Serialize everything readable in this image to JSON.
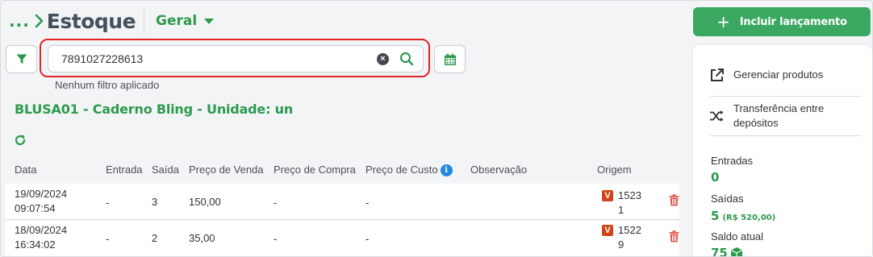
{
  "header": {
    "breadcrumb_dots": "...",
    "title": "Estoque",
    "view_selector": "Geral"
  },
  "toolbar": {
    "search_value": "7891027228613",
    "search_placeholder": "",
    "no_filter_text": "Nenhum filtro aplicado"
  },
  "product": {
    "title": "BLUSA01 - Caderno Bling - Unidade: un"
  },
  "table": {
    "columns": [
      "Data",
      "Entrada",
      "Saída",
      "Preço de Venda",
      "Preço de Compra",
      "Preço de Custo",
      "Observação",
      "Origem"
    ],
    "rows": [
      {
        "date": "19/09/2024",
        "time": "09:07:54",
        "entrada": "-",
        "saida": "3",
        "preco_venda": "150,00",
        "preco_compra": "-",
        "preco_custo": "-",
        "observacao": "",
        "origem_badge": "V",
        "origem_line1": "1523",
        "origem_line2": "1"
      },
      {
        "date": "18/09/2024",
        "time": "16:34:02",
        "entrada": "-",
        "saida": "2",
        "preco_venda": "35,00",
        "preco_compra": "-",
        "preco_custo": "-",
        "observacao": "",
        "origem_badge": "V",
        "origem_line1": "1522",
        "origem_line2": "9"
      }
    ]
  },
  "sidebar": {
    "add_button_label": "Incluir lançamento",
    "links": [
      {
        "label": "Gerenciar produtos"
      },
      {
        "label_line1": "Transferência entre",
        "label_line2": "depósitos"
      }
    ],
    "stats": {
      "entradas_label": "Entradas",
      "entradas_value": "0",
      "saidas_label": "Saídas",
      "saidas_value": "5",
      "saidas_sub": "(R$ 520,00)",
      "saldo_label": "Saldo atual",
      "saldo_value": "75"
    }
  },
  "colors": {
    "brand_green": "#2b9a4e",
    "button_green": "#3aa860",
    "highlight_red": "#e0242a",
    "origin_badge": "#d14418",
    "delete_red": "#e05a4f",
    "info_blue": "#1e88e5"
  },
  "icons": [
    "chevron-right-icon",
    "caret-down-icon",
    "filter-icon",
    "clear-icon",
    "search-icon",
    "calendar-icon",
    "refresh-icon",
    "info-icon",
    "trash-icon",
    "plus-icon",
    "external-link-icon",
    "shuffle-icon",
    "box-icon"
  ]
}
